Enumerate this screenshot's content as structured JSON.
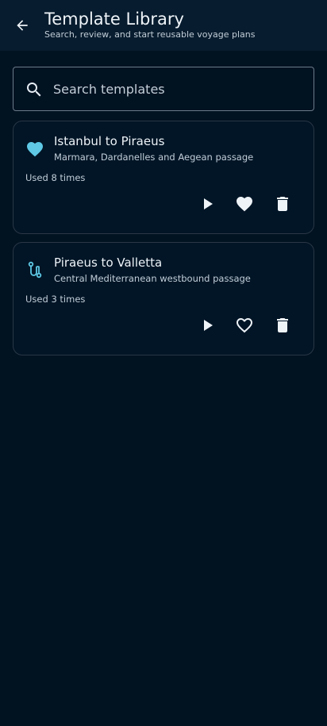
{
  "header": {
    "title": "Template Library",
    "subtitle": "Search, review, and start reusable voyage plans",
    "back_icon": "arrow-back-icon"
  },
  "search": {
    "placeholder": "Search templates",
    "value": "",
    "icon": "search-icon"
  },
  "templates": [
    {
      "title": "Istanbul to Piraeus",
      "description": "Marmara, Dardanelles and Aegean passage",
      "usage": "Used 8 times",
      "icon": "heart-filled-icon",
      "favorite": true
    },
    {
      "title": "Piraeus to Valletta",
      "description": "Central Mediterranean westbound passage",
      "usage": "Used 3 times",
      "icon": "route-icon",
      "favorite": false
    }
  ],
  "colors": {
    "background": "#011221",
    "app_bar": "#071c2e",
    "accent": "#5ec8e5",
    "text_primary": "#eef3f8",
    "text_secondary": "#c2cdd8",
    "card_border": "#2a3745"
  }
}
